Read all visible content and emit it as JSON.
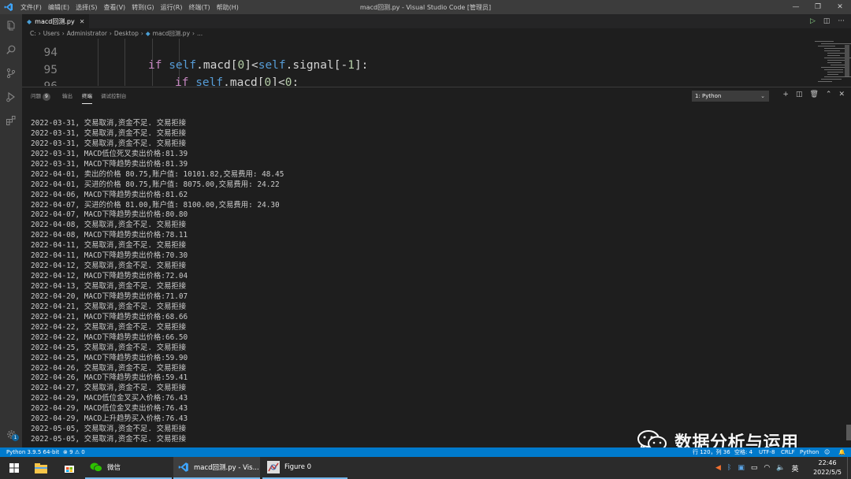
{
  "titlebar": {
    "menu": [
      "文件(F)",
      "编辑(E)",
      "选择(S)",
      "查看(V)",
      "转到(G)",
      "运行(R)",
      "终端(T)",
      "帮助(H)"
    ],
    "title": "macd回测.py - Visual Studio Code [管理员]",
    "min": "—",
    "restore": "❐",
    "close": "✕"
  },
  "tab": {
    "label": "macd回测.py"
  },
  "breadcrumb": {
    "parts": [
      "C:",
      "Users",
      "Administrator",
      "Desktop"
    ],
    "file": "macd回测.py",
    "tail": "..."
  },
  "code": {
    "lines": [
      {
        "num": "94"
      },
      {
        "num": "95"
      },
      {
        "num": "96"
      }
    ]
  },
  "panel": {
    "tabs": {
      "problems": "问题",
      "problems_count": "9",
      "output": "输出",
      "terminal": "终端",
      "debug": "调试控制台"
    },
    "terminal_select": "1: Python"
  },
  "terminal": {
    "lines": [
      "2022-03-31, 交易取消,资金不足. 交易拒接",
      "2022-03-31, 交易取消,资金不足. 交易拒接",
      "2022-03-31, 交易取消,资金不足. 交易拒接",
      "2022-03-31, MACD低位死叉卖出价格:81.39",
      "2022-03-31, MACD下降趋势卖出价格:81.39",
      "2022-04-01, 卖出的价格 80.75,账户值: 10101.82,交易费用: 48.45",
      "2022-04-01, 买进的价格 80.75,账户值: 8075.00,交易费用: 24.22",
      "2022-04-06, MACD下降趋势卖出价格:81.62",
      "2022-04-07, 买进的价格 81.00,账户值: 8100.00,交易费用: 24.30",
      "2022-04-07, MACD下降趋势卖出价格:80.80",
      "2022-04-08, 交易取消,资金不足. 交易拒接",
      "2022-04-08, MACD下降趋势卖出价格:78.11",
      "2022-04-11, 交易取消,资金不足. 交易拒接",
      "2022-04-11, MACD下降趋势卖出价格:70.30",
      "2022-04-12, 交易取消,资金不足. 交易拒接",
      "2022-04-12, MACD下降趋势卖出价格:72.04",
      "2022-04-13, 交易取消,资金不足. 交易拒接",
      "2022-04-20, MACD下降趋势卖出价格:71.07",
      "2022-04-21, 交易取消,资金不足. 交易拒接",
      "2022-04-21, MACD下降趋势卖出价格:68.66",
      "2022-04-22, 交易取消,资金不足. 交易拒接",
      "2022-04-22, MACD下降趋势卖出价格:66.50",
      "2022-04-25, 交易取消,资金不足. 交易拒接",
      "2022-04-25, MACD下降趋势卖出价格:59.90",
      "2022-04-26, 交易取消,资金不足. 交易拒接",
      "2022-04-26, MACD下降趋势卖出价格:59.41",
      "2022-04-27, 交易取消,资金不足. 交易拒接",
      "2022-04-29, MACD低位金叉买入价格:76.43",
      "2022-04-29, MACD低位金叉卖出价格:76.43",
      "2022-04-29, MACD上升趋势买入价格:76.43",
      "2022-05-05, 交易取消,资金不足. 交易拒接",
      "2022-05-05, 交易取消,资金不足. 交易拒接"
    ]
  },
  "watermark": {
    "text": "数据分析与运用"
  },
  "statusbar": {
    "interpreter": "Python 3.9.5 64-bit",
    "problems": "⊗ 9 ⚠ 0",
    "position": "行 120，列 36",
    "spaces": "空格: 4",
    "encoding": "UTF-8",
    "eol": "CRLF",
    "language": "Python"
  },
  "taskbar": {
    "wechat": "微信",
    "vscode": "macd回测.py - Vis...",
    "figure": "Figure 0",
    "ime": "英",
    "time": "22:46",
    "date": "2022/5/5"
  },
  "colors": {
    "accent": "#007acc",
    "editor_bg": "#1e1e1e",
    "panel_text": "#cccccc"
  }
}
